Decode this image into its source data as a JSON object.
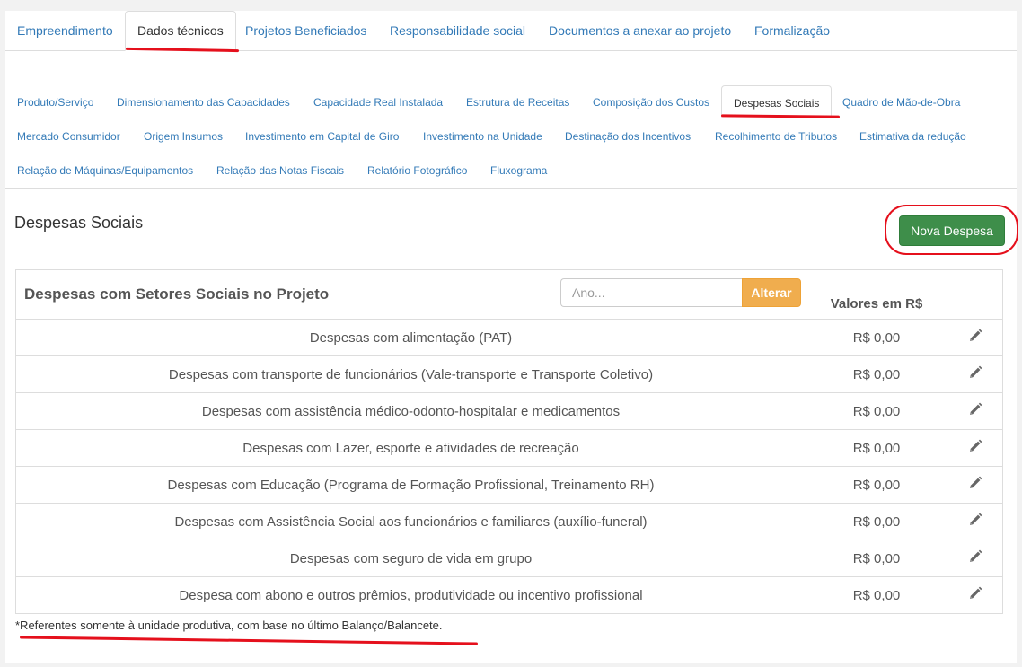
{
  "top_tabs": [
    {
      "label": "Empreendimento",
      "active": false
    },
    {
      "label": "Dados técnicos",
      "active": true
    },
    {
      "label": "Projetos Beneficiados",
      "active": false
    },
    {
      "label": "Responsabilidade social",
      "active": false
    },
    {
      "label": "Documentos a anexar ao projeto",
      "active": false
    },
    {
      "label": "Formalização",
      "active": false
    }
  ],
  "sub_tabs": [
    {
      "label": "Produto/Serviço"
    },
    {
      "label": "Dimensionamento das Capacidades"
    },
    {
      "label": "Capacidade Real Instalada"
    },
    {
      "label": "Estrutura de Receitas"
    },
    {
      "label": "Composição dos Custos"
    },
    {
      "label": "Despesas Sociais",
      "active": true
    },
    {
      "label": "Quadro de Mão-de-Obra"
    },
    {
      "label": "Mercado Consumidor"
    },
    {
      "label": "Origem Insumos"
    },
    {
      "label": "Investimento em Capital de Giro"
    },
    {
      "label": "Investimento na Unidade"
    },
    {
      "label": "Destinação dos Incentivos"
    },
    {
      "label": "Recolhimento de Tributos"
    },
    {
      "label": "Estimativa da redução"
    },
    {
      "label": "Relação de Máquinas/Equipamentos"
    },
    {
      "label": "Relação das Notas Fiscais"
    },
    {
      "label": "Relatório Fotográfico"
    },
    {
      "label": "Fluxograma"
    }
  ],
  "section": {
    "title": "Despesas Sociais",
    "new_button": "Nova Despesa"
  },
  "table": {
    "title": "Despesas com Setores Sociais no Projeto",
    "year_placeholder": "Ano...",
    "alter_button": "Alterar",
    "values_header": "Valores em R$",
    "rows": [
      {
        "desc": "Despesas com alimentação (PAT)",
        "value": "R$ 0,00"
      },
      {
        "desc": "Despesas com transporte de funcionários (Vale-transporte e Transporte Coletivo)",
        "value": "R$ 0,00"
      },
      {
        "desc": "Despesas com assistência médico-odonto-hospitalar e medicamentos",
        "value": "R$ 0,00"
      },
      {
        "desc": "Despesas com Lazer, esporte e atividades de recreação",
        "value": "R$ 0,00"
      },
      {
        "desc": "Despesas com Educação (Programa de Formação Profissional, Treinamento RH)",
        "value": "R$ 0,00"
      },
      {
        "desc": "Despesas com Assistência Social aos funcionários e familiares (auxílio-funeral)",
        "value": "R$ 0,00"
      },
      {
        "desc": "Despesas com seguro de vida em grupo",
        "value": "R$ 0,00"
      },
      {
        "desc": "Despesa com abono e outros prêmios, produtividade ou incentivo profissional",
        "value": "R$ 0,00"
      }
    ]
  },
  "note": "*Referentes somente à unidade produtiva, com base no último Balanço/Balancete.",
  "colors": {
    "link": "#337ab7",
    "success": "#3e8e4a",
    "warning": "#f0ad4e",
    "annotation": "#e5101c"
  },
  "icons": {
    "edit": "pencil-icon"
  }
}
